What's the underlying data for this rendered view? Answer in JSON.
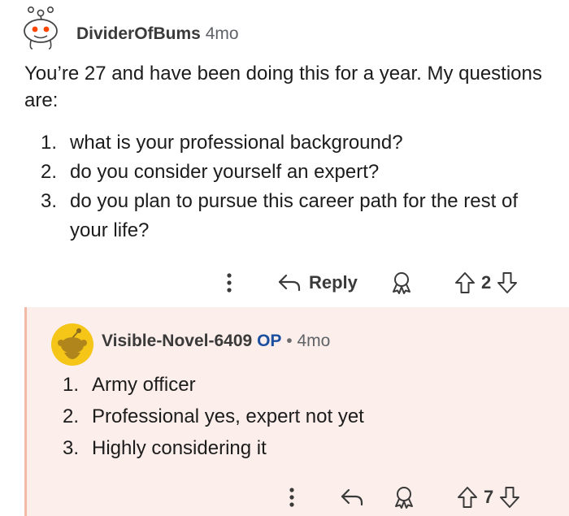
{
  "comment": {
    "author": "DividerOfBums",
    "age": "4mo",
    "body": "You’re 27 and have been doing this for a year. My questions are:",
    "list": [
      {
        "num": "1.",
        "text": "what is your professional background?"
      },
      {
        "num": "2.",
        "text": "do you consider yourself an expert?"
      },
      {
        "num": "3.",
        "text": "do you plan to pursue this career path for the rest of your life?"
      }
    ],
    "actions": {
      "more_icon": "more-vertical-icon",
      "reply_icon": "reply-arrow-icon",
      "reply_label": "Reply",
      "award_icon": "award-icon",
      "upvote_icon": "upvote-arrow-icon",
      "score": "2",
      "downvote_icon": "downvote-arrow-icon"
    }
  },
  "reply": {
    "author": "Visible-Novel-6409",
    "op_badge": "OP",
    "separator": "•",
    "age": "4mo",
    "list": [
      {
        "num": "1.",
        "text": "Army officer"
      },
      {
        "num": "2.",
        "text": "Professional yes, expert not yet"
      },
      {
        "num": "3.",
        "text": "Highly considering it"
      }
    ],
    "actions": {
      "more_icon": "more-vertical-icon",
      "reply_icon": "reply-arrow-icon",
      "award_icon": "award-icon",
      "upvote_icon": "upvote-arrow-icon",
      "score": "7",
      "downvote_icon": "downvote-arrow-icon"
    }
  },
  "colors": {
    "reply_background": "#fceeea",
    "reply_thread_line": "#f2b8a8",
    "op_badge": "#1a4fa0",
    "snoo_accent": "#ff4500",
    "avatar_yellow": "#f5c518"
  }
}
